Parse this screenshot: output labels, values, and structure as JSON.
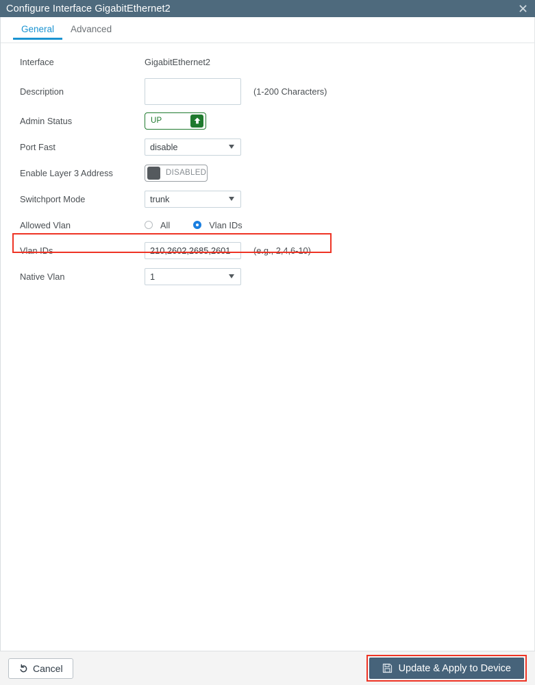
{
  "titlebar": {
    "title": "Configure Interface GigabitEthernet2",
    "close_icon": "close-icon"
  },
  "tabs": [
    {
      "label": "General",
      "active": true
    },
    {
      "label": "Advanced",
      "active": false
    }
  ],
  "form": {
    "interface": {
      "label": "Interface",
      "value": "GigabitEthernet2"
    },
    "description": {
      "label": "Description",
      "value": "",
      "placeholder": "",
      "hint": "(1-200 Characters)"
    },
    "admin_status": {
      "label": "Admin Status",
      "state_text": "UP",
      "icon": "arrow-up-icon"
    },
    "port_fast": {
      "label": "Port Fast",
      "value": "disable",
      "caret_icon": "chevron-down-icon"
    },
    "enable_layer3": {
      "label": "Enable Layer 3 Address",
      "state_text": "DISABLED"
    },
    "switchport_mode": {
      "label": "Switchport Mode",
      "value": "trunk",
      "caret_icon": "chevron-down-icon"
    },
    "allowed_vlan": {
      "label": "Allowed Vlan",
      "options": [
        {
          "label": "All",
          "selected": false
        },
        {
          "label": "Vlan IDs",
          "selected": true
        }
      ]
    },
    "vlan_ids": {
      "label": "Vlan IDs",
      "value": "210,2602,2685,2601",
      "hint": "(e.g., 2,4,6-10)"
    },
    "native_vlan": {
      "label": "Native Vlan",
      "value": "1",
      "caret_icon": "chevron-down-icon"
    }
  },
  "footer": {
    "cancel_label": "Cancel",
    "cancel_icon": "undo-icon",
    "primary_label": "Update & Apply to Device",
    "primary_icon": "save-icon"
  },
  "colors": {
    "titlebar": "#4e6a7d",
    "accent_blue": "#1a93d1",
    "radio_blue": "#1a7fe0",
    "toggle_green": "#1f7a2e",
    "toggle_gray": "#555a5e",
    "highlight_red": "#ee3324",
    "primary_button": "#46637a"
  }
}
